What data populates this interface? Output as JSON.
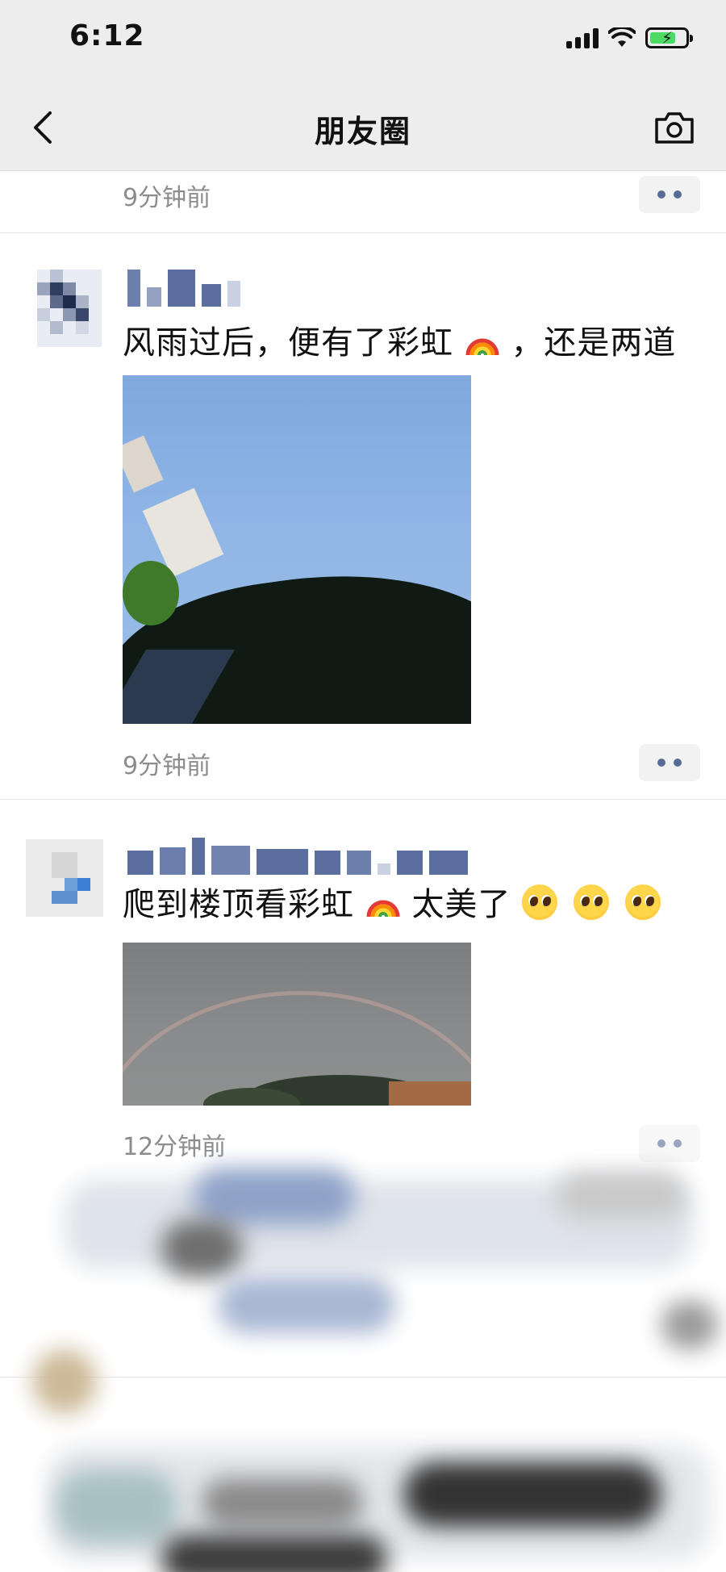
{
  "status_bar": {
    "time": "6:12"
  },
  "nav": {
    "title": "朋友圈"
  },
  "feed": {
    "prev_post": {
      "time": "9分钟前"
    },
    "post1": {
      "text": "风雨过后，便有了彩虹",
      "text_after_emoji": "，还是两道",
      "emoji": "rainbow",
      "time": "9分钟前"
    },
    "post2": {
      "text": "爬到楼顶看彩虹",
      "text_after_emoji": " 太美了",
      "emoji": "rainbow",
      "trailing_emojis": [
        "pleading-face",
        "pleading-face",
        "pleading-face"
      ],
      "time": "12分钟前"
    }
  },
  "colors": {
    "nav_background": "#ededed",
    "link_blue": "#586b96",
    "timestamp_gray": "#8c8c8c"
  },
  "icons": [
    "back-chevron-icon",
    "camera-icon",
    "more-dots-icon",
    "signal-icon",
    "wifi-icon",
    "battery-charging-icon"
  ]
}
